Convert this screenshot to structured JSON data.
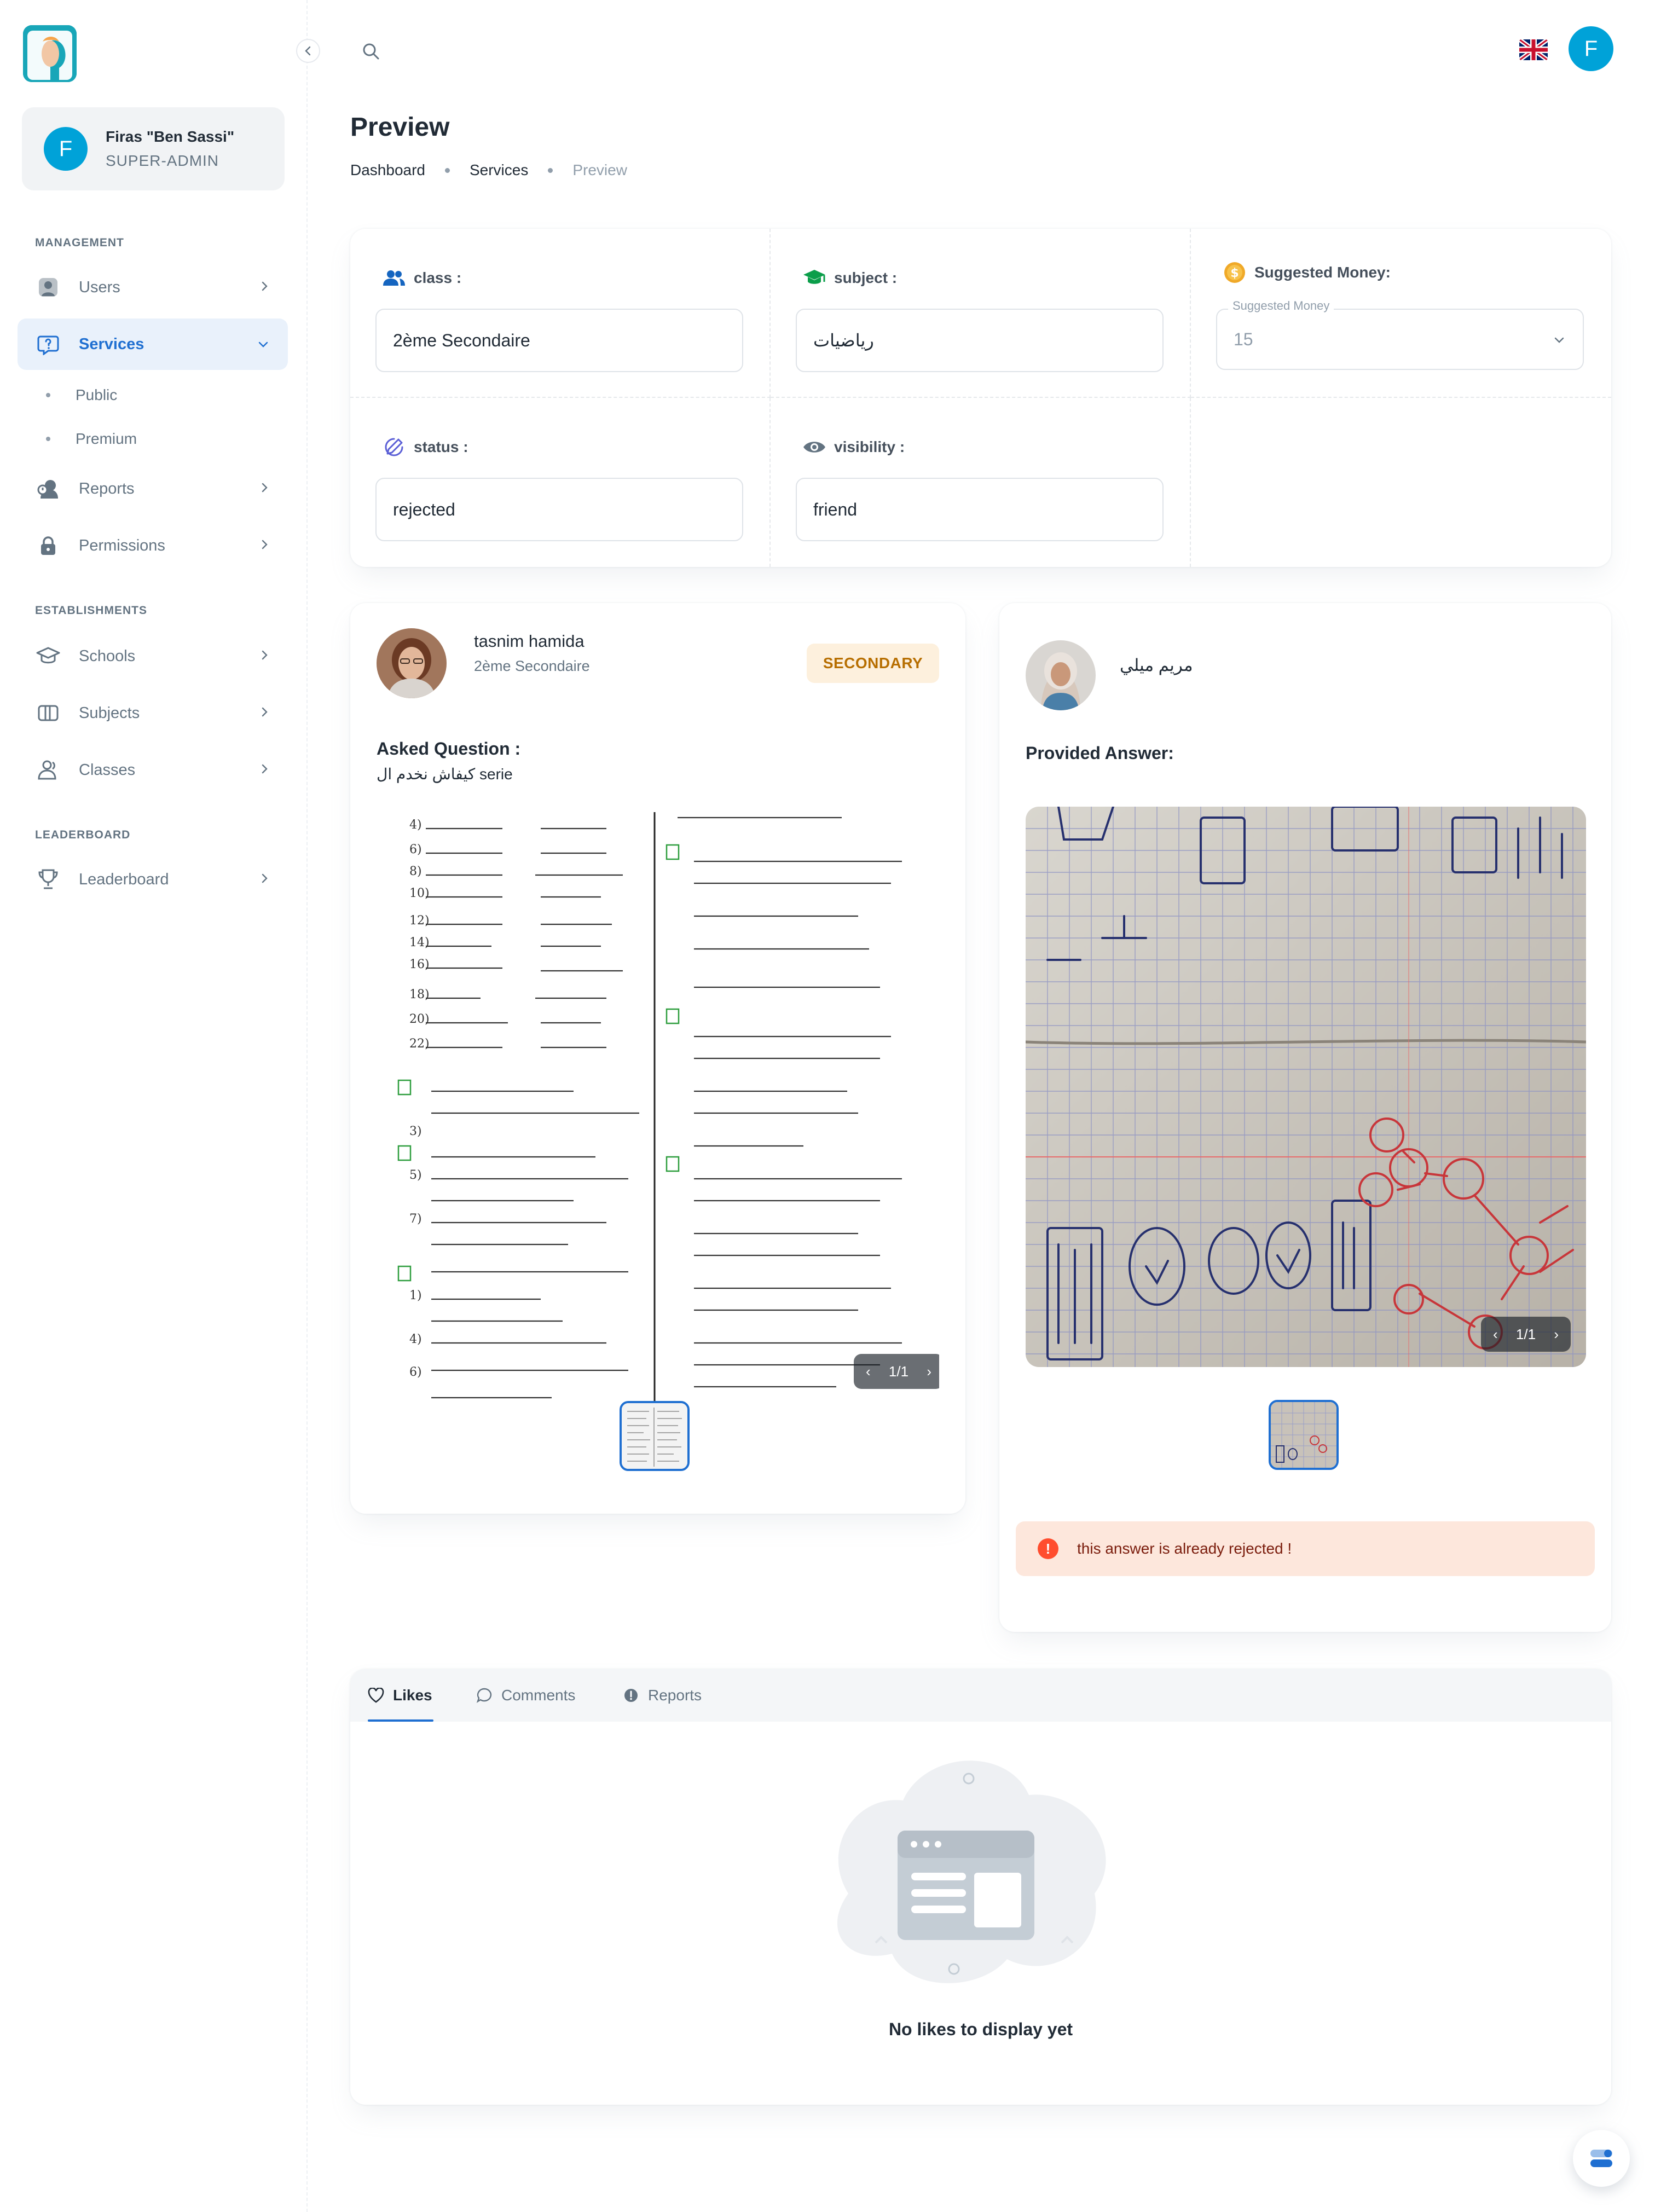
{
  "sidebar": {
    "account": {
      "initial": "F",
      "name": "Firas \"Ben Sassi\"",
      "role": "SUPER-ADMIN"
    },
    "sections": {
      "management": "MANAGEMENT",
      "establishments": "ESTABLISHMENTS",
      "leaderboard": "LEADERBOARD"
    },
    "items": {
      "users": "Users",
      "services": "Services",
      "public": "Public",
      "premium": "Premium",
      "reports": "Reports",
      "permissions": "Permissions",
      "schools": "Schools",
      "subjects": "Subjects",
      "classes": "Classes",
      "leaderboard": "Leaderboard"
    },
    "active_item": "services"
  },
  "header": {
    "language_icon": "uk-flag-icon",
    "avatar_initial": "F"
  },
  "page": {
    "title": "Preview",
    "breadcrumb": [
      "Dashboard",
      "Services",
      "Preview"
    ]
  },
  "info": {
    "class": {
      "label": "class :",
      "value": "2ème Secondaire"
    },
    "subject": {
      "label": "subject :",
      "value": "رياضيات"
    },
    "money": {
      "label": "Suggested Money:",
      "field_label": "Suggested Money",
      "value": "15"
    },
    "status": {
      "label": "status :",
      "value": "rejected"
    },
    "visibility": {
      "label": "visibility :",
      "value": "friend"
    }
  },
  "question": {
    "author": "tasnim hamida",
    "level": "2ème Secondaire",
    "badge": "SECONDARY",
    "section_label": "Asked Question :",
    "text": "كيفاش نخدم ال serie",
    "pager": "1/1"
  },
  "answer": {
    "author": "مريم ميلي",
    "section_label": "Provided Answer:",
    "pager": "1/1",
    "alert": "this answer is already rejected !"
  },
  "tabs": {
    "items": [
      "Likes",
      "Comments",
      "Reports"
    ],
    "active": 0,
    "empty_text": "No likes to display yet"
  },
  "colors": {
    "primary": "#1f6fd1",
    "avatar": "#00a2d8",
    "badge_bg": "#fdf0dd",
    "badge_text": "#b76e00",
    "alert_bg": "#fde7dc",
    "alert_icon": "#ff4d2e"
  }
}
